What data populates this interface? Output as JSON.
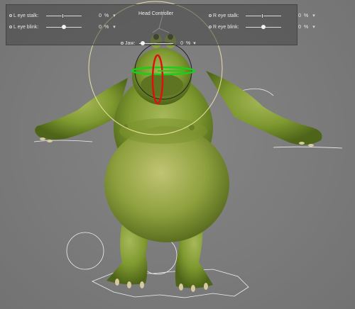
{
  "controls": {
    "head_controller": "Head Controller",
    "left_eye_stalk": {
      "label": "L eye stalk:",
      "value": "0",
      "unit": "%",
      "level": 0.5
    },
    "left_eye_blink": {
      "label": "L eye blink:",
      "value": "0",
      "unit": "%",
      "level": 0.5
    },
    "right_eye_stalk": {
      "label": "R eye stalk:",
      "value": "0",
      "unit": "%",
      "level": 0.5
    },
    "right_eye_blink": {
      "label": "R eye blink:",
      "value": "0",
      "unit": "%",
      "level": 0.5
    },
    "jaw": {
      "label": "Jaw:",
      "value": "0",
      "unit": "%",
      "level": 0.1
    }
  },
  "colors": {
    "background": "#7b7b7b",
    "skin": "#8aa23a",
    "gizmo_red": "#e01010",
    "gizmo_green": "#18d018",
    "controller_circle": "#e8e0a0",
    "rig_outline": "#f0f0f0"
  },
  "icons": [
    "chevron-down-icon",
    "radio-bullet-icon"
  ]
}
